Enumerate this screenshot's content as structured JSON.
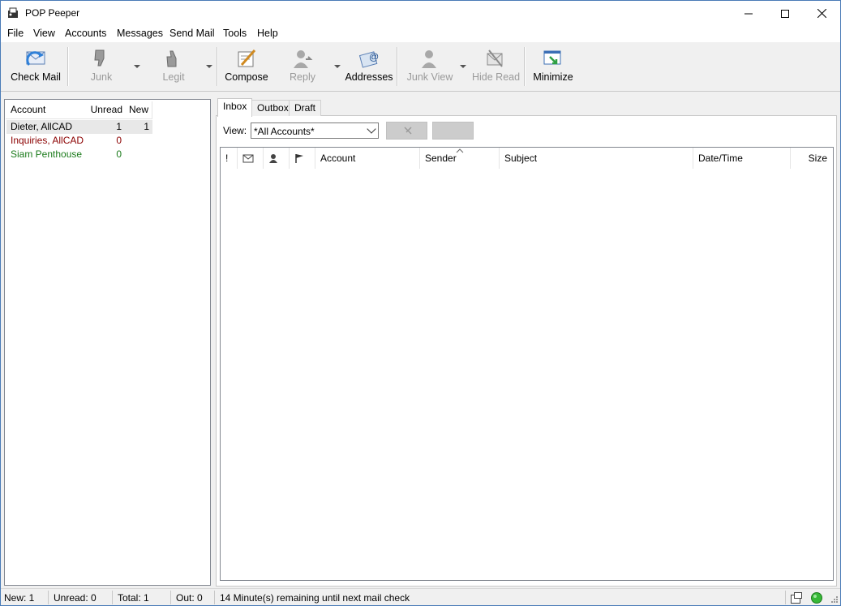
{
  "window": {
    "title": "POP Peeper"
  },
  "menu": [
    "File",
    "View",
    "Accounts",
    "Messages",
    "Send Mail",
    "Tools",
    "Help"
  ],
  "toolbar": {
    "check_mail": "Check Mail",
    "junk": "Junk",
    "legit": "Legit",
    "compose": "Compose",
    "reply": "Reply",
    "addresses": "Addresses",
    "junk_view": "Junk View",
    "hide_read": "Hide Read",
    "minimize": "Minimize"
  },
  "accounts": {
    "headers": {
      "account": "Account",
      "unread": "Unread",
      "new": "New"
    },
    "rows": [
      {
        "name": "Dieter, AllCAD",
        "unread": "1",
        "new": "1",
        "color": "#000000"
      },
      {
        "name": "Inquiries, AllCAD",
        "unread": "0",
        "new": "",
        "color": "#8b0000"
      },
      {
        "name": "Siam Penthouse",
        "unread": "0",
        "new": "",
        "color": "#1a7a1a"
      }
    ]
  },
  "tabs": [
    "Inbox",
    "Outbox",
    "Draft"
  ],
  "view": {
    "label": "View:",
    "selected": "*All Accounts*"
  },
  "message_list": {
    "columns": [
      "!",
      "Account",
      "Sender",
      "Subject",
      "Date/Time",
      "Size"
    ]
  },
  "status": {
    "new": "New: 1",
    "unread": "Unread: 0",
    "total": "Total: 1",
    "out": "Out: 0",
    "message": "14 Minute(s) remaining until next mail check"
  },
  "icons": [
    "app-icon",
    "check-mail-icon",
    "junk-icon",
    "legit-icon",
    "compose-icon",
    "reply-icon",
    "addresses-icon",
    "junk-view-icon",
    "hide-read-icon",
    "minimize-icon",
    "envelope-icon",
    "person-icon",
    "flag-icon",
    "sort-up-icon",
    "window-icon",
    "status-ok-icon"
  ]
}
